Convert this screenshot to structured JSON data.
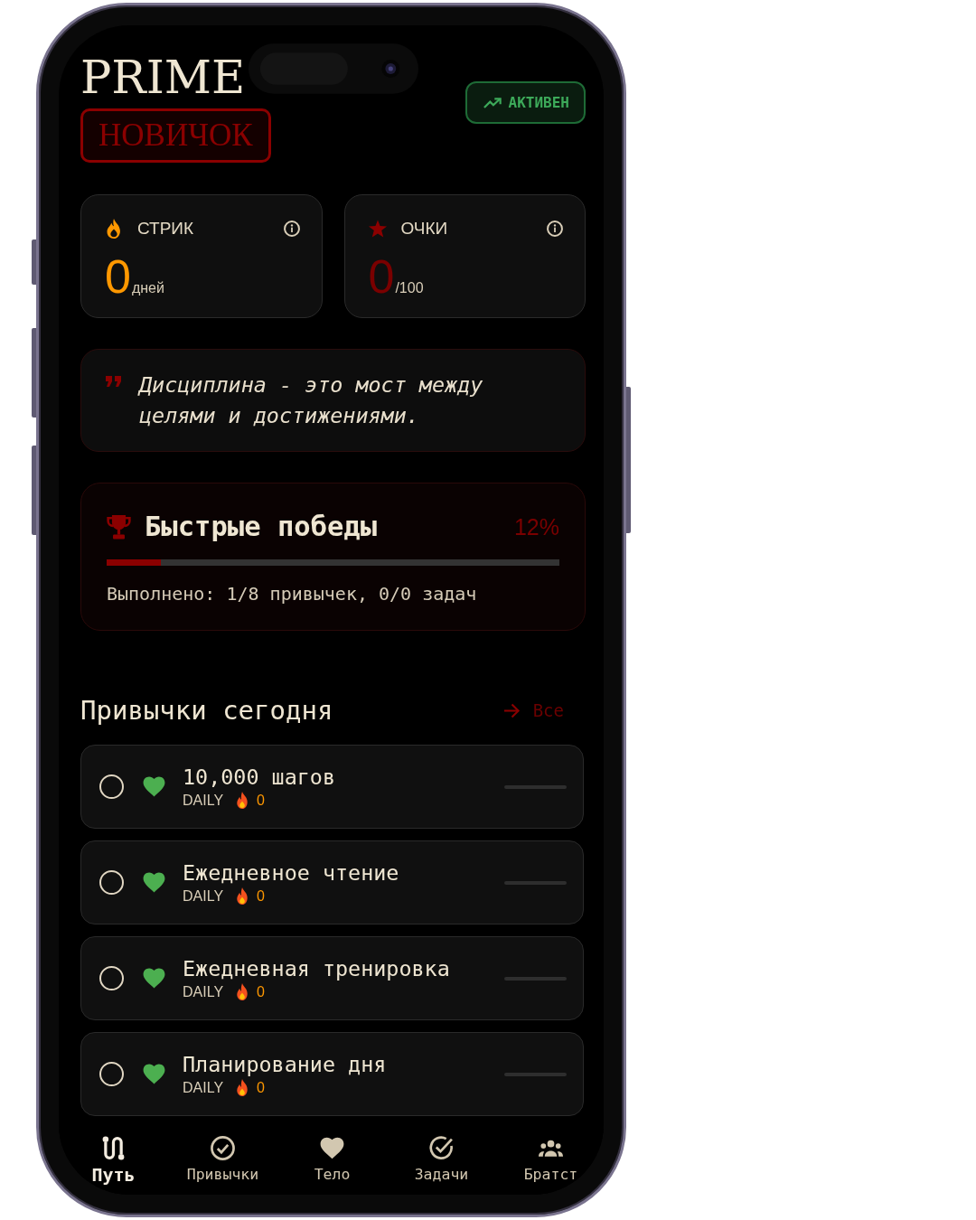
{
  "header": {
    "title": "PRIME",
    "rank_badge": "НОВИЧОК",
    "status_badge": "АКТИВЕН"
  },
  "stats": [
    {
      "kind": "streak",
      "label": "СТРИК",
      "value": "0",
      "unit": "дней"
    },
    {
      "kind": "points",
      "label": "ОЧКИ",
      "value": "0",
      "unit": "/100"
    }
  ],
  "quote": {
    "text": "Дисциплина - это мост между целями и достижениями."
  },
  "quick_wins": {
    "title": "Быстрые победы",
    "percent": "12%",
    "level": 0.12,
    "summary": "Выполнено: 1/8 привычек, 0/0 задач"
  },
  "habits_section": {
    "title": "Привычки сегодня",
    "link": "Все"
  },
  "habits": [
    {
      "title": "10,000 шагов",
      "frequency": "DAILY",
      "streak": "0",
      "checked": false,
      "level": 0
    },
    {
      "title": "Ежедневное чтение",
      "frequency": "DAILY",
      "streak": "0",
      "checked": false,
      "level": 0
    },
    {
      "title": "Ежедневная тренировка",
      "frequency": "DAILY",
      "streak": "0",
      "checked": false,
      "level": 0
    },
    {
      "title": "Планирование дня",
      "frequency": "DAILY",
      "streak": "0",
      "checked": false,
      "level": 0
    }
  ],
  "nav": [
    {
      "kind": "path",
      "label": "Путь",
      "selected": true
    },
    {
      "kind": "habits",
      "label": "Привычки",
      "selected": false
    },
    {
      "kind": "body",
      "label": "Тело",
      "selected": false
    },
    {
      "kind": "tasks",
      "label": "Задачи",
      "selected": false
    },
    {
      "kind": "brotherhood",
      "label": "Братст",
      "selected": false
    }
  ]
}
